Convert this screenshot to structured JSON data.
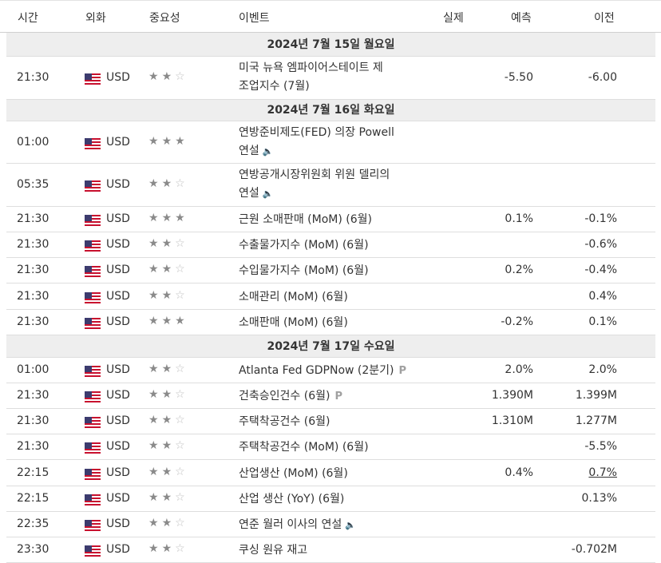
{
  "header": {
    "time": "시간",
    "currency": "외화",
    "importance": "중요성",
    "event": "이벤트",
    "actual": "실제",
    "forecast": "예측",
    "previous": "이전"
  },
  "sections": [
    {
      "date": "2024년 7월 15일 월요일"
    },
    {
      "date": "2024년 7월 16일 화요일"
    },
    {
      "date": "2024년 7월 17일 수요일"
    }
  ],
  "icons": {
    "flag": "us-flag-icon",
    "star": "star-icon",
    "speaker": "speaker-icon",
    "preliminary": "preliminary-p-icon"
  },
  "events": [
    {
      "time": "21:30",
      "cur": "USD",
      "imp": 2,
      "name1": "미국 뉴욕 엠파이어스테이트 제",
      "name2": "조업지수 (7월)",
      "actual": "",
      "forecast": "-5.50",
      "previous": "-6.00"
    },
    {
      "time": "01:00",
      "cur": "USD",
      "imp": 3,
      "name1": "연방준비제도(FED) 의장 Powell",
      "name2": "연설",
      "speech": "🔈",
      "actual": "",
      "forecast": "",
      "previous": ""
    },
    {
      "time": "05:35",
      "cur": "USD",
      "imp": 2,
      "name1": "연방공개시장위원회 위원 델리의",
      "name2": "연설",
      "speech": "🔈",
      "actual": "",
      "forecast": "",
      "previous": ""
    },
    {
      "time": "21:30",
      "cur": "USD",
      "imp": 3,
      "name1": "근원 소매판매 (MoM) (6월)",
      "actual": "",
      "forecast": "0.1%",
      "previous": "-0.1%"
    },
    {
      "time": "21:30",
      "cur": "USD",
      "imp": 2,
      "name1": "수출물가지수 (MoM) (6월)",
      "actual": "",
      "forecast": "",
      "previous": "-0.6%"
    },
    {
      "time": "21:30",
      "cur": "USD",
      "imp": 2,
      "name1": "수입물가지수 (MoM) (6월)",
      "actual": "",
      "forecast": "0.2%",
      "previous": "-0.4%"
    },
    {
      "time": "21:30",
      "cur": "USD",
      "imp": 2,
      "name1": "소매관리 (MoM) (6월)",
      "actual": "",
      "forecast": "",
      "previous": "0.4%"
    },
    {
      "time": "21:30",
      "cur": "USD",
      "imp": 3,
      "name1": "소매판매 (MoM) (6월)",
      "actual": "",
      "forecast": "-0.2%",
      "previous": "0.1%"
    },
    {
      "time": "01:00",
      "cur": "USD",
      "imp": 2,
      "name1": "Atlanta Fed GDPNow (2분기)",
      "prelim": "P",
      "actual": "",
      "forecast": "2.0%",
      "previous": "2.0%"
    },
    {
      "time": "21:30",
      "cur": "USD",
      "imp": 2,
      "name1": "건축승인건수 (6월)",
      "prelim": "P",
      "actual": "",
      "forecast": "1.390M",
      "previous": "1.399M"
    },
    {
      "time": "21:30",
      "cur": "USD",
      "imp": 2,
      "name1": "주택착공건수 (6월)",
      "actual": "",
      "forecast": "1.310M",
      "previous": "1.277M"
    },
    {
      "time": "21:30",
      "cur": "USD",
      "imp": 2,
      "name1": "주택착공건수 (MoM) (6월)",
      "actual": "",
      "forecast": "",
      "previous": "-5.5%"
    },
    {
      "time": "22:15",
      "cur": "USD",
      "imp": 2,
      "name1": "산업생산 (MoM) (6월)",
      "actual": "",
      "forecast": "0.4%",
      "previous": "0.7%",
      "prevLink": true
    },
    {
      "time": "22:15",
      "cur": "USD",
      "imp": 2,
      "name1": "산업 생산 (YoY) (6월)",
      "actual": "",
      "forecast": "",
      "previous": "0.13%"
    },
    {
      "time": "22:35",
      "cur": "USD",
      "imp": 2,
      "name1": "연준 월러 이사의 연설",
      "speech": "🔈",
      "actual": "",
      "forecast": "",
      "previous": ""
    },
    {
      "time": "23:30",
      "cur": "USD",
      "imp": 2,
      "name1": "쿠싱 원유 재고",
      "actual": "",
      "forecast": "",
      "previous": "-0.702M"
    }
  ]
}
